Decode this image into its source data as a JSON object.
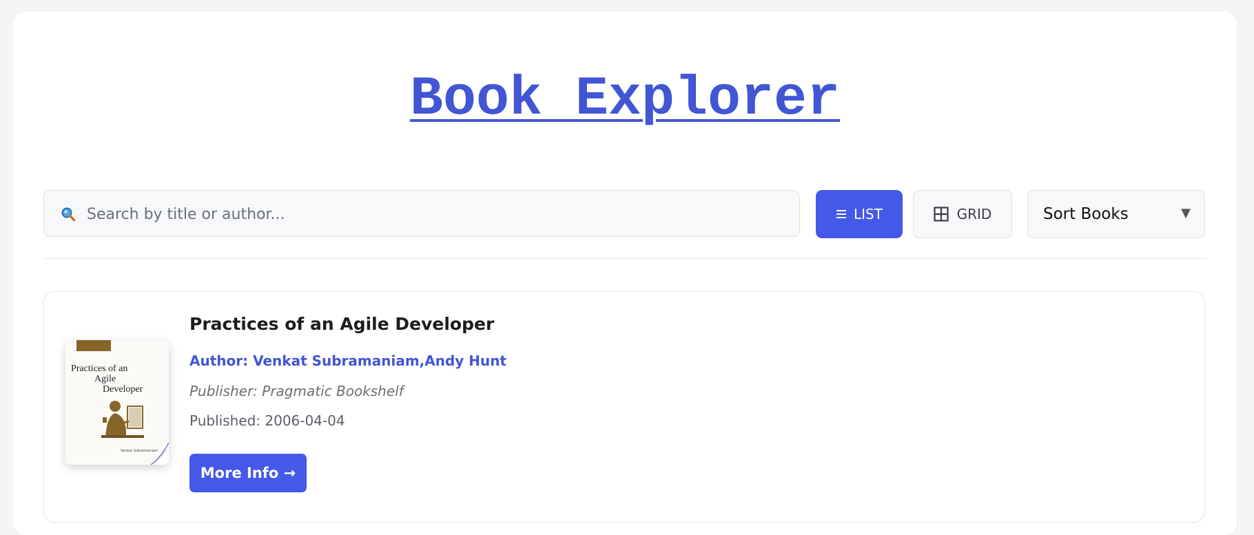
{
  "header": {
    "title": "Book Explorer"
  },
  "toolbar": {
    "search": {
      "icon": "magnifier-icon",
      "placeholder": "Search by title or author...",
      "value": ""
    },
    "view_toggle": {
      "list_label": "LIST",
      "list_icon": "list-icon",
      "grid_label": "GRID",
      "grid_icon": "grid-icon",
      "active": "list"
    },
    "sort": {
      "selected": "Sort Books",
      "arrow_icon": "caret-down-icon"
    }
  },
  "colors": {
    "accent": "#4559e8",
    "title": "#4255d4",
    "cover_brown": "#86652b"
  },
  "books": [
    {
      "title": "Practices of an Agile Developer",
      "author": "Author: Venkat Subramaniam,Andy Hunt",
      "publisher": "Publisher: Pragmatic Bookshelf",
      "published": "Published: 2006-04-04",
      "cta_label": "More Info →",
      "cover": {
        "title_line_1": "Practices of an",
        "title_line_2": "Agile",
        "title_line_3": "Developer",
        "author_line": "Venkat Subramaniam"
      }
    }
  ]
}
